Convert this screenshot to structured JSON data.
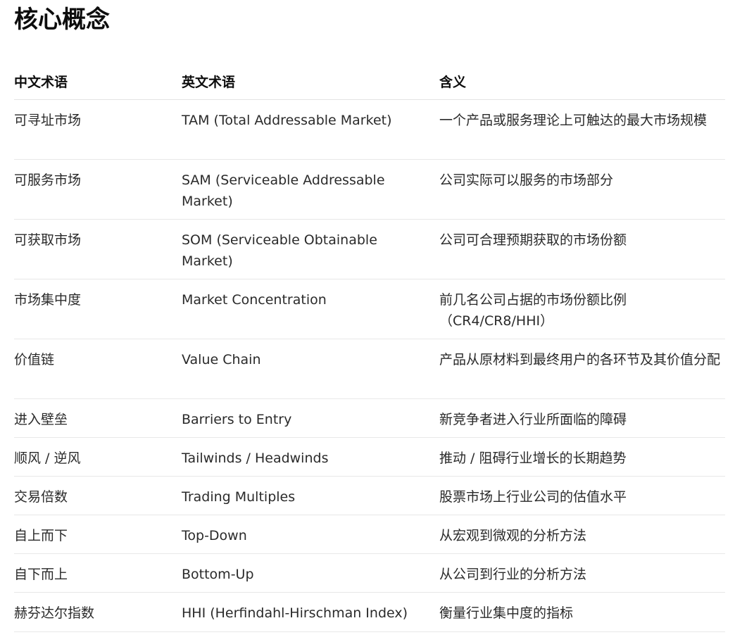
{
  "title": "核心概念",
  "table": {
    "headers": [
      "中文术语",
      "英文术语",
      "含义"
    ],
    "rows": [
      {
        "zh": "可寻址市场",
        "en": "TAM (Total Addressable Market)",
        "meaning": "一个产品或服务理论上可触达的最大市场规模"
      },
      {
        "zh": "可服务市场",
        "en": "SAM (Serviceable Addressable Market)",
        "meaning": "公司实际可以服务的市场部分"
      },
      {
        "zh": "可获取市场",
        "en": "SOM (Serviceable Obtainable Market)",
        "meaning": "公司可合理预期获取的市场份额"
      },
      {
        "zh": "市场集中度",
        "en": "Market Concentration",
        "meaning": "前几名公司占据的市场份额比例（CR4/CR8/HHI）"
      },
      {
        "zh": "价值链",
        "en": "Value Chain",
        "meaning": "产品从原材料到最终用户的各环节及其价值分配"
      },
      {
        "zh": "进入壁垒",
        "en": "Barriers to Entry",
        "meaning": "新竞争者进入行业所面临的障碍"
      },
      {
        "zh": "顺风 / 逆风",
        "en": "Tailwinds / Headwinds",
        "meaning": "推动 / 阻碍行业增长的长期趋势"
      },
      {
        "zh": "交易倍数",
        "en": "Trading Multiples",
        "meaning": "股票市场上行业公司的估值水平"
      },
      {
        "zh": "自上而下",
        "en": "Top-Down",
        "meaning": "从宏观到微观的分析方法"
      },
      {
        "zh": "自下而上",
        "en": "Bottom-Up",
        "meaning": "从公司到行业的分析方法"
      },
      {
        "zh": "赫芬达尔指数",
        "en": "HHI (Herfindahl-Hirschman Index)",
        "meaning": "衡量行业集中度的指标"
      }
    ]
  }
}
